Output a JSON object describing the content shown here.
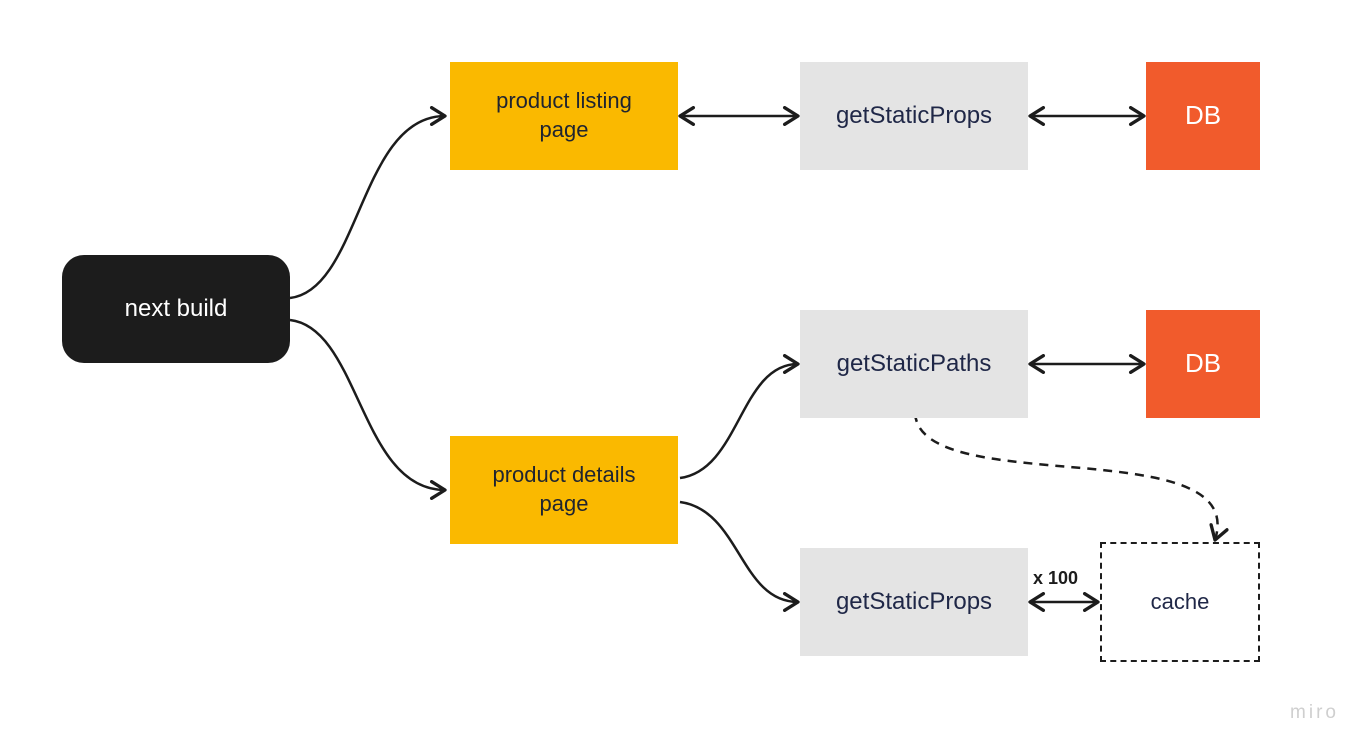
{
  "nodes": {
    "next_build": {
      "label": "next build"
    },
    "product_listing": {
      "label": "product listing\npage"
    },
    "product_details": {
      "label": "product details\npage"
    },
    "gsp_listing": {
      "label": "getStaticProps"
    },
    "gspaths": {
      "label": "getStaticPaths"
    },
    "gsp_details": {
      "label": "getStaticProps"
    },
    "db1": {
      "label": "DB"
    },
    "db2": {
      "label": "DB"
    },
    "cache": {
      "label": "cache"
    }
  },
  "edges": {
    "gsp_cache_label": "x 100"
  },
  "watermark": "miro",
  "colors": {
    "black": "#1c1c1c",
    "yellow": "#fab900",
    "grey": "#e4e4e4",
    "orange": "#f15b2c",
    "text_dark_blue": "#1f2747"
  }
}
